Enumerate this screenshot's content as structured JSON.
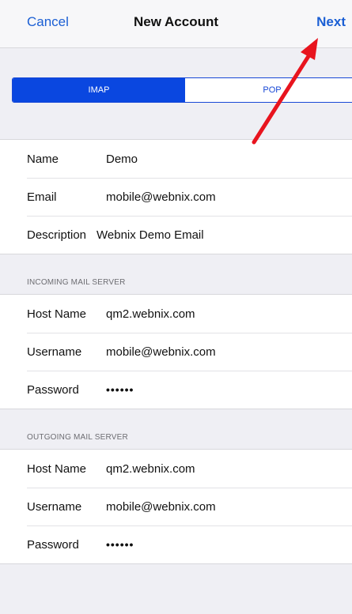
{
  "nav": {
    "cancel": "Cancel",
    "title": "New Account",
    "next": "Next"
  },
  "segment": {
    "options": [
      "IMAP",
      "POP"
    ],
    "selected": "IMAP"
  },
  "account": {
    "name_label": "Name",
    "name_value": "Demo",
    "email_label": "Email",
    "email_value": "mobile@webnix.com",
    "description_label": "Description",
    "description_value": "Webnix Demo Email"
  },
  "incoming": {
    "header": "INCOMING MAIL SERVER",
    "host_label": "Host Name",
    "host_value": "qm2.webnix.com",
    "username_label": "Username",
    "username_value": "mobile@webnix.com",
    "password_label": "Password",
    "password_value": "••••••"
  },
  "outgoing": {
    "header": "OUTGOING MAIL SERVER",
    "host_label": "Host Name",
    "host_value": "qm2.webnix.com",
    "username_label": "Username",
    "username_value": "mobile@webnix.com",
    "password_label": "Password",
    "password_value": "••••••"
  },
  "colors": {
    "accent": "#1b5fd4",
    "segment_selected": "#0a47e0",
    "annotation_arrow": "#e8141e"
  },
  "annotation": {
    "icon": "red-arrow-icon",
    "points_to": "next-button"
  }
}
